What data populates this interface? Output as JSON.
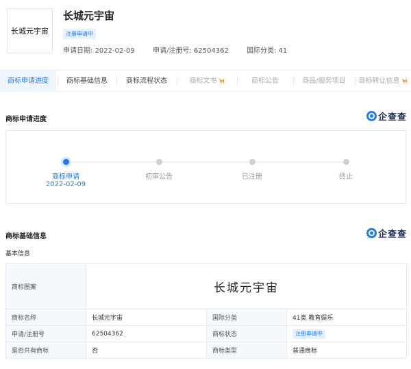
{
  "header": {
    "logo_text": "长城元宇宙",
    "title": "长城元宇宙",
    "status_badge": "注册申请中",
    "apply_date": "申请日期: 2022-02-09",
    "reg_no": "申请/注册号: 62504362",
    "intl_class": "国际分类: 41"
  },
  "tabs": [
    {
      "label": "商标申请进度",
      "state": "active"
    },
    {
      "label": "商标基础信息",
      "state": "normal"
    },
    {
      "label": "商标流程状态",
      "state": "normal"
    },
    {
      "label": "商标文书",
      "state": "disabled",
      "icon": "vip-icon"
    },
    {
      "label": "商标公告",
      "state": "disabled"
    },
    {
      "label": "商品/服务项目",
      "state": "disabled"
    },
    {
      "label": "商标转让信息",
      "state": "disabled",
      "icon": "vip-icon"
    }
  ],
  "progress": {
    "title": "商标申请进度",
    "brand": "企查查",
    "steps": [
      {
        "label": "商标申请",
        "date": "2022-02-09",
        "active": true
      },
      {
        "label": "初审公告",
        "date": "",
        "active": false
      },
      {
        "label": "已注册",
        "date": "",
        "active": false
      },
      {
        "label": "终止",
        "date": "",
        "active": false
      }
    ]
  },
  "basic": {
    "title": "商标基础信息",
    "brand": "企查查",
    "subtitle": "基本信息",
    "image_label": "商标图案",
    "image_text": "长城元宇宙",
    "rows": [
      {
        "l1": "商标名称",
        "v1": "长城元宇宙",
        "l2": "国际分类",
        "v2": "41类 教育娱乐"
      },
      {
        "l1": "申请/注册号",
        "v1": "62504362",
        "l2": "商标状态",
        "v2": "注册申请中"
      },
      {
        "l1": "是否共有商标",
        "v1": "否",
        "l2": "商标类型",
        "v2": "普通商标"
      }
    ]
  },
  "colors": {
    "accent": "#1e7bf0",
    "label_bg": "#f5f8fc"
  }
}
